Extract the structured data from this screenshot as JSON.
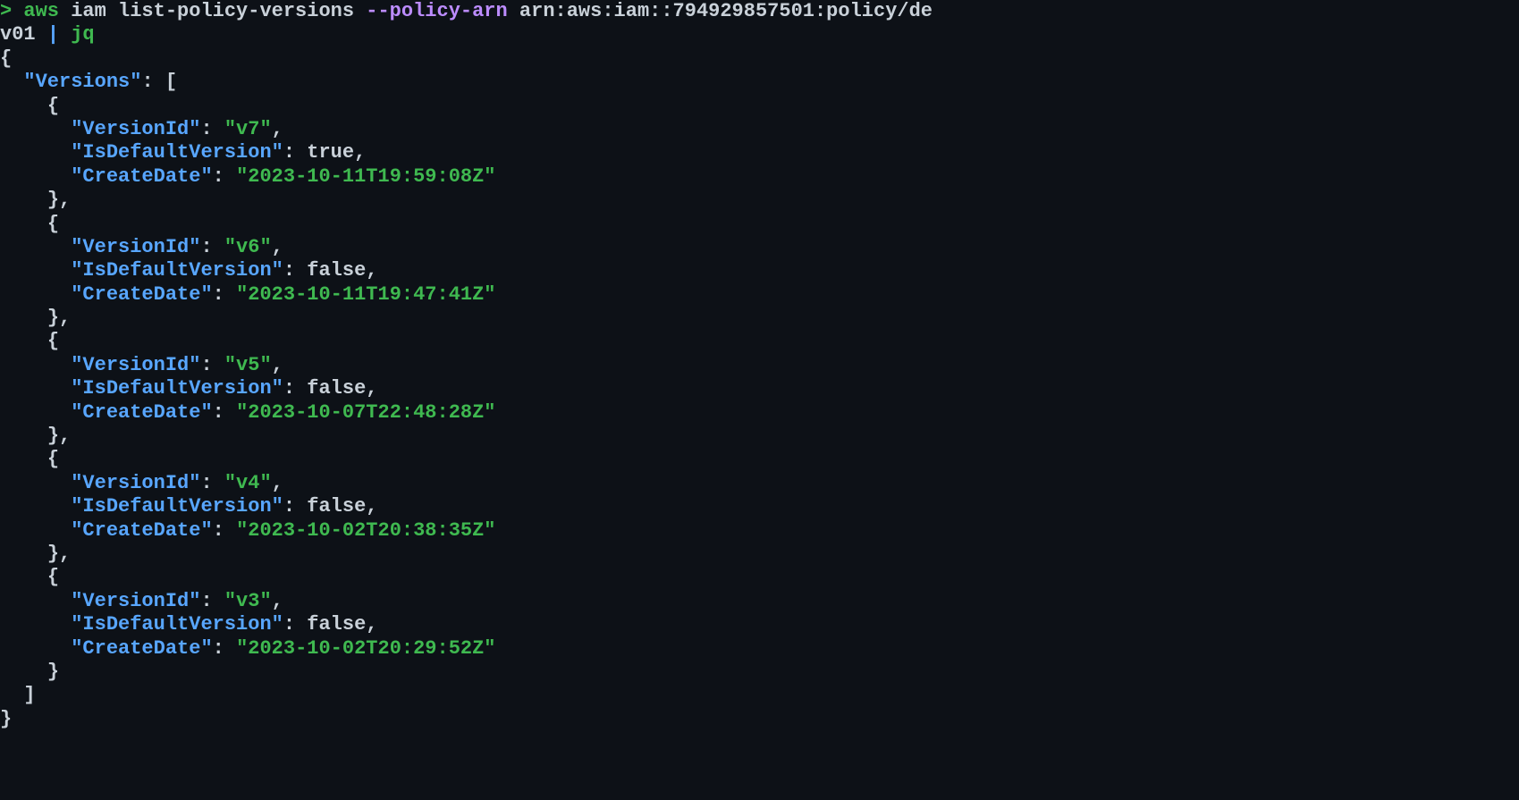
{
  "prompt": {
    "caret": ">",
    "aws": "aws",
    "subcommand": "iam list-policy-versions",
    "flag": "--policy-arn",
    "arg_part1": "arn:aws:iam::794929857501:policy/de",
    "arg_part2": "v01",
    "pipe": "|",
    "jq": "jq"
  },
  "json": {
    "open_brace": "{",
    "close_brace": "}",
    "versions_key": "\"Versions\"",
    "colon": ":",
    "open_bracket": "[",
    "close_bracket": "]",
    "comma": ",",
    "version_id_key": "\"VersionId\"",
    "is_default_key": "\"IsDefaultVersion\"",
    "create_date_key": "\"CreateDate\"",
    "true_val": "true",
    "false_val": "false"
  },
  "versions": [
    {
      "VersionId": "\"v7\"",
      "IsDefaultVersion": "true",
      "CreateDate": "\"2023-10-11T19:59:08Z\""
    },
    {
      "VersionId": "\"v6\"",
      "IsDefaultVersion": "false",
      "CreateDate": "\"2023-10-11T19:47:41Z\""
    },
    {
      "VersionId": "\"v5\"",
      "IsDefaultVersion": "false",
      "CreateDate": "\"2023-10-07T22:48:28Z\""
    },
    {
      "VersionId": "\"v4\"",
      "IsDefaultVersion": "false",
      "CreateDate": "\"2023-10-02T20:38:35Z\""
    },
    {
      "VersionId": "\"v3\"",
      "IsDefaultVersion": "false",
      "CreateDate": "\"2023-10-02T20:29:52Z\""
    }
  ]
}
